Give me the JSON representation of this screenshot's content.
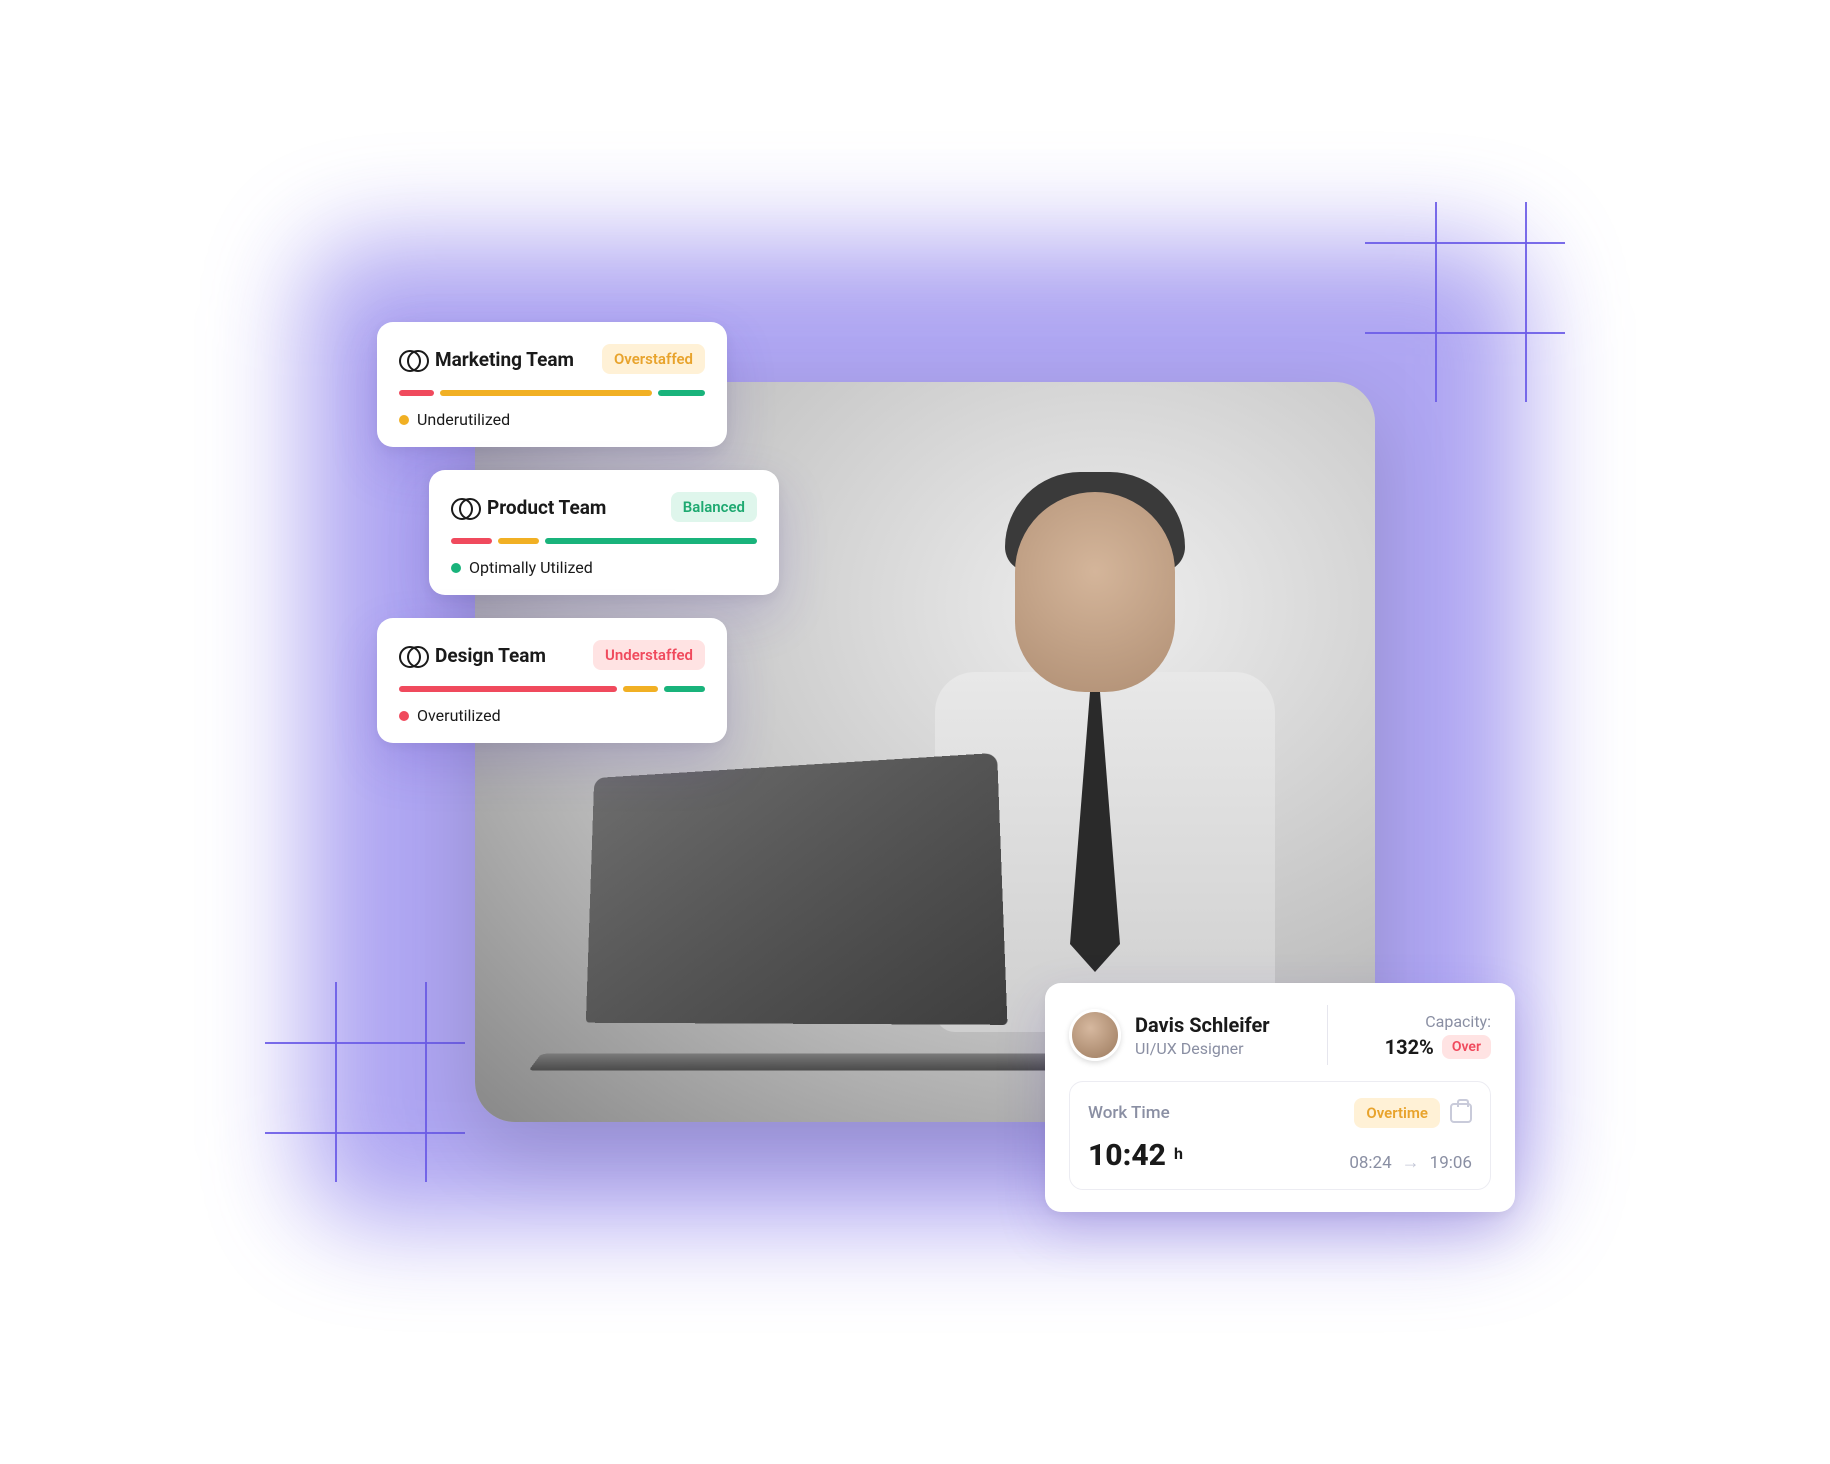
{
  "teams": [
    {
      "name": "Marketing Team",
      "status": "Overstaffed",
      "status_style": "over",
      "segments": [
        {
          "color": "r",
          "pct": 12
        },
        {
          "color": "y",
          "pct": 72
        },
        {
          "color": "g",
          "pct": 16
        }
      ],
      "legend": {
        "color": "#F1B024",
        "text": "Underutilized"
      }
    },
    {
      "name": "Product Team",
      "status": "Balanced",
      "status_style": "bal",
      "segments": [
        {
          "color": "r",
          "pct": 14
        },
        {
          "color": "y",
          "pct": 14
        },
        {
          "color": "g",
          "pct": 72
        }
      ],
      "legend": {
        "color": "#19B37B",
        "text": "Optimally Utilized"
      }
    },
    {
      "name": "Design Team",
      "status": "Understaffed",
      "status_style": "under",
      "segments": [
        {
          "color": "r",
          "pct": 74
        },
        {
          "color": "y",
          "pct": 12
        },
        {
          "color": "g",
          "pct": 14
        }
      ],
      "legend": {
        "color": "#F04A5D",
        "text": "Overutilized"
      }
    }
  ],
  "user": {
    "name": "Davis Schleifer",
    "role": "UI/UX Designer",
    "capacity_label": "Capacity:",
    "capacity_value": "132%",
    "capacity_badge": "Over"
  },
  "worktime": {
    "label": "Work Time",
    "badge": "Overtime",
    "duration": "10:42",
    "unit": "h",
    "start": "08:24",
    "end": "19:06"
  },
  "colors": {
    "accent": "#6C5CE7",
    "red": "#F04A5D",
    "yellow": "#F1B024",
    "green": "#19B37B"
  }
}
